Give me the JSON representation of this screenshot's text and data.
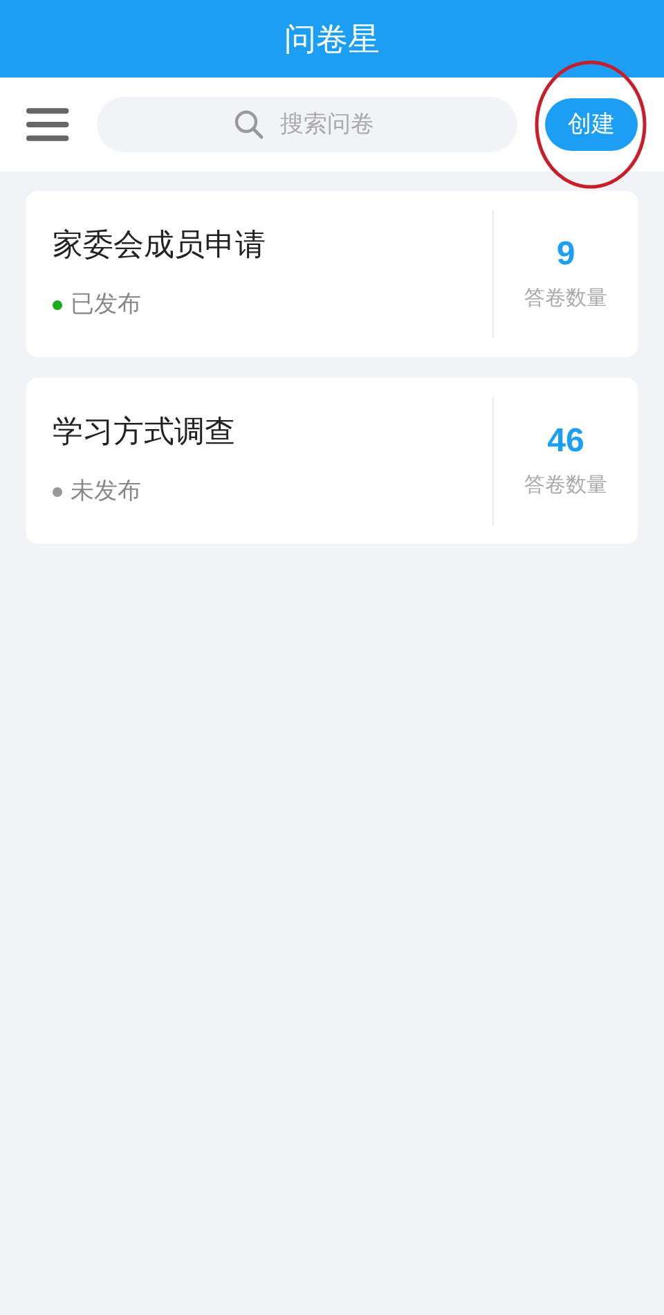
{
  "header": {
    "title": "问卷星"
  },
  "toolbar": {
    "search": {
      "placeholder": "搜索问卷"
    },
    "create_button": "创建"
  },
  "surveys": [
    {
      "title": "家委会成员申请",
      "status": "已发布",
      "color": "#1aad19",
      "count": "9",
      "count_label": "答卷数量"
    },
    {
      "title": "学习方式调查",
      "status": "未发布",
      "color": "#999999",
      "count": "46",
      "count_label": "答卷数量"
    }
  ]
}
